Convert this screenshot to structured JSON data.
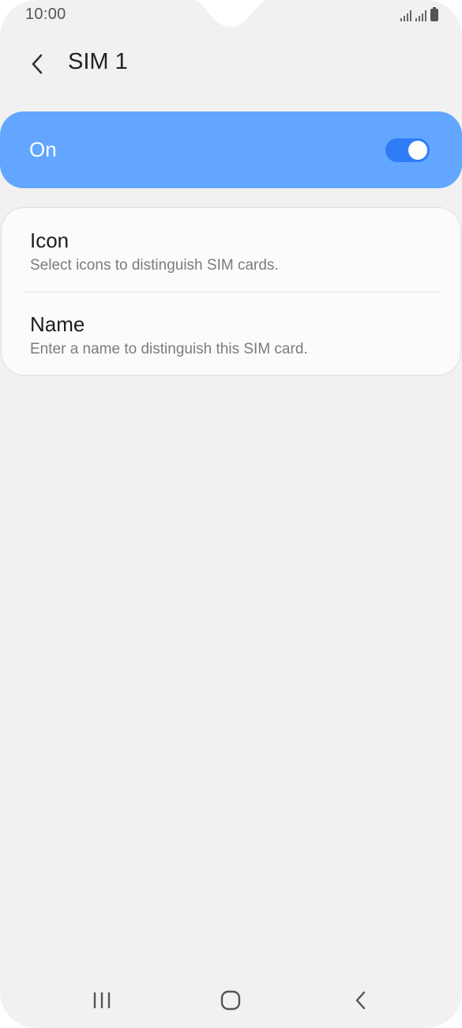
{
  "status_bar": {
    "time": "10:00"
  },
  "header": {
    "title": "SIM 1",
    "back_icon": "chevron-left-icon"
  },
  "toggle_card": {
    "label": "On",
    "state": "on",
    "accent_color": "#62a6ff",
    "toggle_color": "#2f7df6"
  },
  "settings": [
    {
      "title": "Icon",
      "subtitle": "Select icons to distinguish SIM cards."
    },
    {
      "title": "Name",
      "subtitle": "Enter a name to distinguish this SIM card."
    }
  ],
  "nav_bar": {
    "recents_icon": "recents-icon",
    "home_icon": "home-icon",
    "back_icon": "back-icon"
  }
}
